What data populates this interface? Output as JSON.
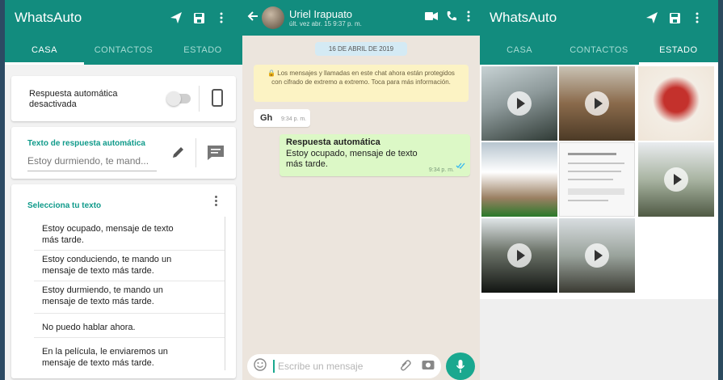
{
  "app_title": "WhatsAuto",
  "tabs": {
    "casa": "CASA",
    "contactos": "CONTACTOS",
    "estado": "ESTADO"
  },
  "panel1": {
    "auto_reply_status": "Respuesta automática\ndesactivada",
    "reply_text_label": "Texto de respuesta automática",
    "reply_text_value": "Estoy durmiendo, te mand...",
    "select_label": "Selecciona tu texto",
    "options": [
      "Estoy ocupado, mensaje de texto\nmás tarde.",
      "Estoy conduciendo, te mando un\nmensaje de texto más tarde.",
      "Estoy durmiendo, te mando un\nmensaje de texto más tarde.",
      "No puedo hablar ahora.",
      "En la película, le enviaremos un\nmensaje de texto más tarde."
    ]
  },
  "panel2": {
    "contact_name": "Uriel Irapuato",
    "last_seen": "últ. vez abr. 15 9:37 p. m.",
    "date_chip": "16 DE ABRIL DE 2019",
    "encryption_note": "🔒 Los mensajes y llamadas en este chat ahora están protegidos con cifrado de extremo a extremo. Toca para más información.",
    "incoming_text": "Gh",
    "incoming_time": "9:34 p. m.",
    "outgoing_title": "Respuesta automática",
    "outgoing_body": "Estoy ocupado, mensaje de texto\nmás tarde.",
    "outgoing_time": "9:34 p. m.",
    "composer_placeholder": "Escribe un mensaje"
  },
  "colors": {
    "header": "#128c7e",
    "accent": "#0f9a8a",
    "out_bubble": "#dcf8c6",
    "chat_bg": "#ece5dd"
  },
  "icons": [
    "send-icon",
    "save-icon",
    "more-vert-icon",
    "back-arrow-icon",
    "video-call-icon",
    "phone-icon",
    "pencil-icon",
    "message-icon",
    "emoji-icon",
    "attach-icon",
    "camera-icon",
    "mic-icon",
    "play-icon"
  ]
}
